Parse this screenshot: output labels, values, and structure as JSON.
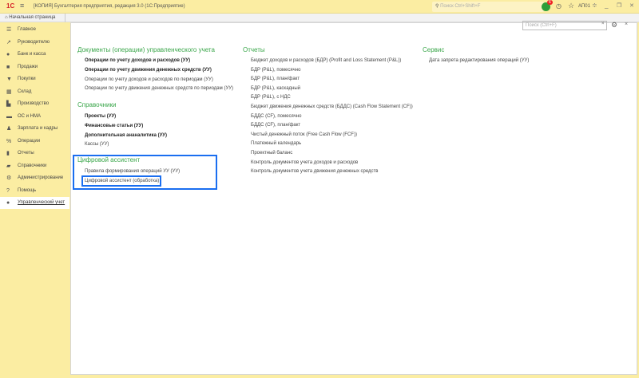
{
  "titlebar": {
    "logo": "1С",
    "title": "[КОПИЯ] Бухгалтерия предприятия, редакция 3.0  (1С:Предприятие)",
    "search_placeholder": "Поиск Ctrl+Shift+F",
    "notifications": "6",
    "user": "АП01"
  },
  "tabs": {
    "home": "Начальная страница"
  },
  "sidebar": {
    "items": [
      {
        "icon": "menu-icon",
        "glyph": "☰",
        "label": "Главное"
      },
      {
        "icon": "trend-icon",
        "glyph": "↗",
        "label": "Руководителю"
      },
      {
        "icon": "bank-icon",
        "glyph": "●",
        "label": "Банк и касса"
      },
      {
        "icon": "bag-icon",
        "glyph": "■",
        "label": "Продажи"
      },
      {
        "icon": "cart-icon",
        "glyph": "▼",
        "label": "Покупки"
      },
      {
        "icon": "warehouse-icon",
        "glyph": "▦",
        "label": "Склад"
      },
      {
        "icon": "factory-icon",
        "glyph": "▙",
        "label": "Производство"
      },
      {
        "icon": "truck-icon",
        "glyph": "▬",
        "label": "ОС и НМА"
      },
      {
        "icon": "person-icon",
        "glyph": "♟",
        "label": "Зарплата и кадры"
      },
      {
        "icon": "operations-icon",
        "glyph": "%",
        "label": "Операции"
      },
      {
        "icon": "reports-icon",
        "glyph": "▮",
        "label": "Отчеты"
      },
      {
        "icon": "book-icon",
        "glyph": "▰",
        "label": "Справочники"
      },
      {
        "icon": "gear-icon",
        "glyph": "⚙",
        "label": "Администрирование"
      },
      {
        "icon": "help-icon",
        "glyph": "?",
        "label": "Помощь"
      },
      {
        "icon": "management-icon",
        "glyph": "●",
        "label": "Управленческий учет"
      }
    ]
  },
  "main": {
    "search_placeholder": "Поиск (Ctrl+F)",
    "docs": {
      "title": "Документы (операции) управленческого учета",
      "items": [
        "Операции по учету доходов и расходов (УУ)",
        "Операции по учету движения денежных средств (УУ)",
        "Операции по учету доходов и расходов по периодам (УУ)",
        "Операции по учету движения денежных средств по периодам (УУ)"
      ]
    },
    "refs": {
      "title": "Справочники",
      "items": [
        "Проекты (УУ)",
        "Финансовые статьи (УУ)",
        "Дополнительная ананалитика (УУ)",
        "Кассы (УУ)"
      ]
    },
    "assistant": {
      "title": "Цифровой ассистент",
      "items": [
        "Правила формирования операций УУ (УУ)",
        "Цифровой ассистент (обработка)"
      ]
    },
    "reports": {
      "title": "Отчеты",
      "items": [
        "Бюджет доходов и расходов (БДР) (Profit and Loss Statement (P&L))",
        "БДР (P&L), помесячно",
        "БДР (P&L), план/факт",
        "БДР (P&L), каскадный",
        "БДР (P&L), с НДС",
        "Бюджет движения денежных средств (БДДС) (Cash Flow Statement (CF))",
        "БДДС (CF), помесячно",
        "БДДС (CF), план/факт",
        "Чистый денежный поток (Free Cash Flow (FCF))",
        "Платежный календарь",
        "Проектный баланс",
        "Контроль документов учета доходов и расходов",
        "Контроль документов учета движения денежных средств"
      ]
    },
    "service": {
      "title": "Сервис",
      "items": [
        "Дата запрета редактирования операций (УУ)"
      ]
    }
  }
}
